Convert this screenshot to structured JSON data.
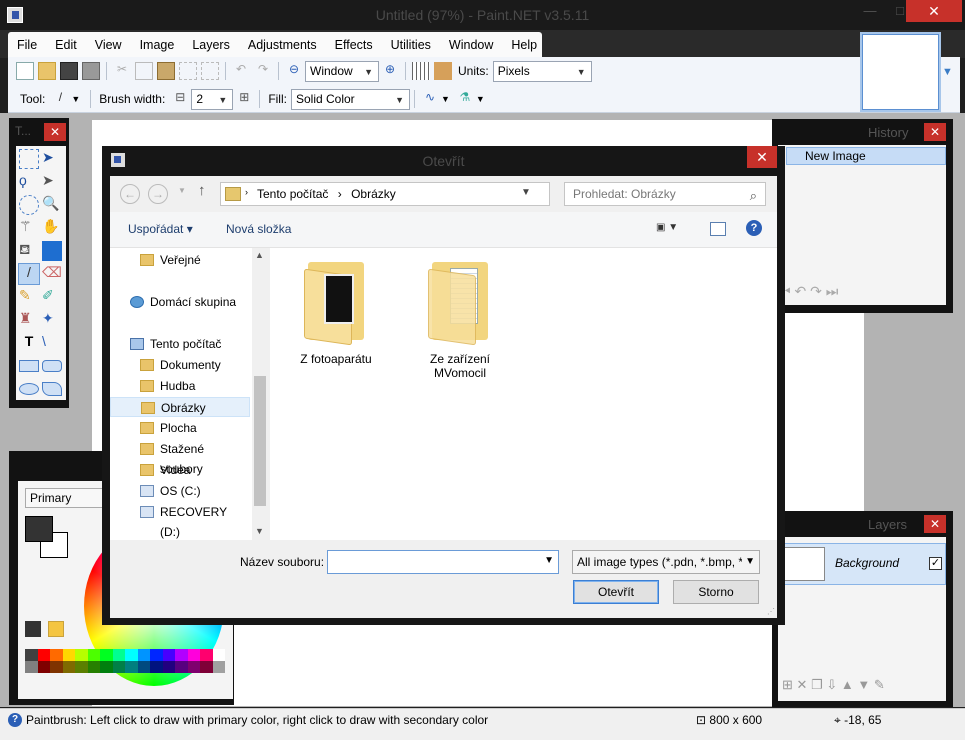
{
  "window": {
    "title": "Untitled (97%) - Paint.NET v3.5.11",
    "min": "—",
    "max": "□",
    "close": "✕"
  },
  "menu": [
    "File",
    "Edit",
    "View",
    "Image",
    "Layers",
    "Adjustments",
    "Effects",
    "Utilities",
    "Window",
    "Help"
  ],
  "toolbar": {
    "zoom_select": "Window",
    "units_label": "Units:",
    "units_value": "Pixels",
    "tool_label": "Tool:",
    "brush_width_label": "Brush width:",
    "brush_width_value": "2",
    "fill_label": "Fill:",
    "fill_value": "Solid Color"
  },
  "panels": {
    "tools_title": "T...",
    "history_title": "History",
    "history_item": "New Image",
    "layers_title": "Layers",
    "layer_name": "Background",
    "colors_select": "Primary",
    "close": "✕"
  },
  "palette": [
    "#404040",
    "#ff0000",
    "#ff6a00",
    "#ffd800",
    "#b6ff00",
    "#4cff00",
    "#00ff21",
    "#00ff90",
    "#00ffff",
    "#0094ff",
    "#0026ff",
    "#4800ff",
    "#b200ff",
    "#ff00dc",
    "#ff006e",
    "#ffffff"
  ],
  "palette2": [
    "#808080",
    "#7f0000",
    "#7f3300",
    "#7f6a00",
    "#5b7f00",
    "#267f00",
    "#007f0e",
    "#007f46",
    "#007f7f",
    "#004a7f",
    "#00137f",
    "#21007f",
    "#57007f",
    "#7f006e",
    "#7f0037",
    "#a0a0a0"
  ],
  "status": {
    "text": "Paintbrush: Left click to draw with primary color, right click to draw with secondary color",
    "size": "800 x 600",
    "coords": "-18, 65"
  },
  "dialog": {
    "title": "Otevřít",
    "close": "✕",
    "address": {
      "pc": "Tento počítač",
      "sep": "›",
      "folder": "Obrázky"
    },
    "search_placeholder": "Prohledat: Obrázky",
    "organize": "Uspořádat ▾",
    "new_folder": "Nová složka",
    "nav_items": [
      {
        "label": "Veřejné",
        "kind": "folder"
      },
      {
        "label": "Domácí skupina",
        "kind": "net"
      },
      {
        "label": "Tento počítač",
        "kind": "pc"
      },
      {
        "label": "Dokumenty",
        "kind": "folder"
      },
      {
        "label": "Hudba",
        "kind": "folder"
      },
      {
        "label": "Obrázky",
        "kind": "folder"
      },
      {
        "label": "Plocha",
        "kind": "folder"
      },
      {
        "label": "Stažené soubory",
        "kind": "folder"
      },
      {
        "label": "Videa",
        "kind": "folder"
      },
      {
        "label": "OS (C:)",
        "kind": "drive"
      },
      {
        "label": "RECOVERY (D:)",
        "kind": "drive"
      }
    ],
    "files": [
      {
        "line1": "Z fotoaparátu",
        "line2": ""
      },
      {
        "line1": "Ze zařízení",
        "line2": "MVomocil"
      }
    ],
    "filename_label": "Název souboru:",
    "filename_value": "",
    "filetype": "All image types (*.pdn, *.bmp, *",
    "open_label": "Otevřít",
    "cancel_label": "Storno"
  }
}
